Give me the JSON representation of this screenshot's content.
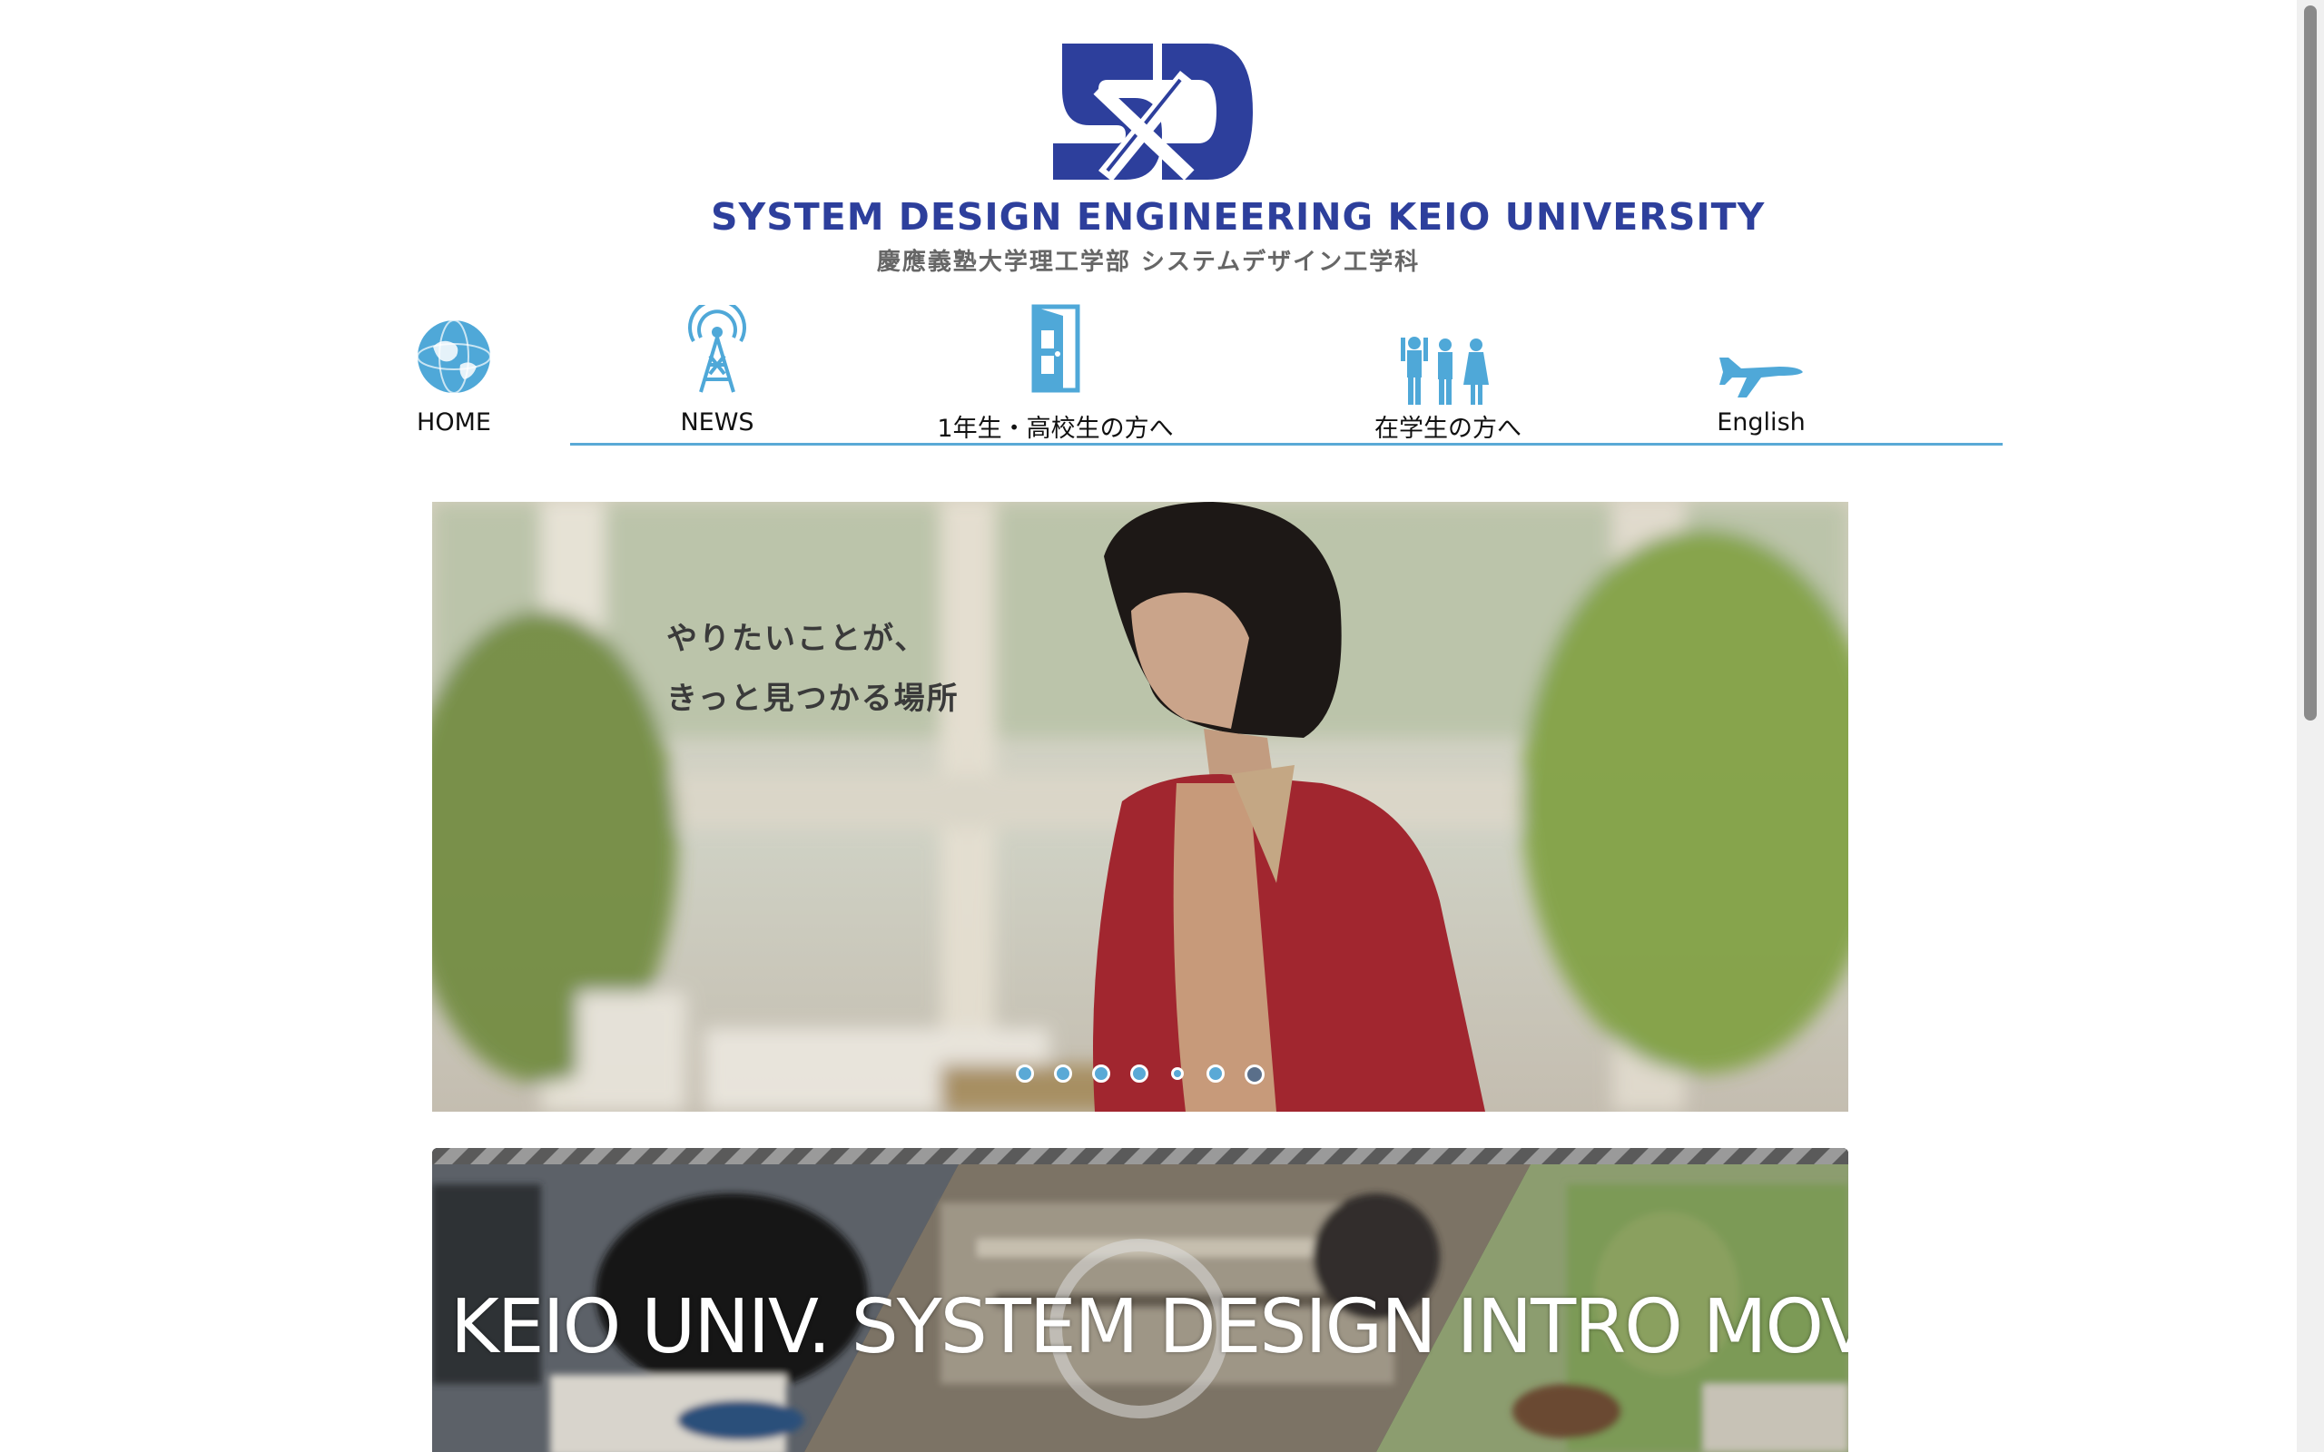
{
  "header": {
    "logo_name": "SD",
    "title": "SYSTEM DESIGN ENGINEERING KEIO UNIVERSITY",
    "subtitle": "慶應義塾大学理工学部 システムデザイン工学科",
    "brand_color": "#2d3f9c"
  },
  "nav": {
    "accent_color": "#4fa8d8",
    "items": [
      {
        "label": "HOME",
        "icon": "globe-icon"
      },
      {
        "label": "NEWS",
        "icon": "radio-tower-icon"
      },
      {
        "label": "1年生・高校生の方へ",
        "icon": "door-icon"
      },
      {
        "label": "在学生の方へ",
        "icon": "people-icon"
      },
      {
        "label": "English",
        "icon": "airplane-icon"
      }
    ]
  },
  "hero": {
    "line1": "やりたいことが、",
    "line2": "きっと見つかる場所",
    "slide_count": 7,
    "active_slide": 7
  },
  "video": {
    "title": "KEIO UNIV. SYSTEM DESIGN INTRO MOVIE",
    "icon": "play-icon"
  }
}
